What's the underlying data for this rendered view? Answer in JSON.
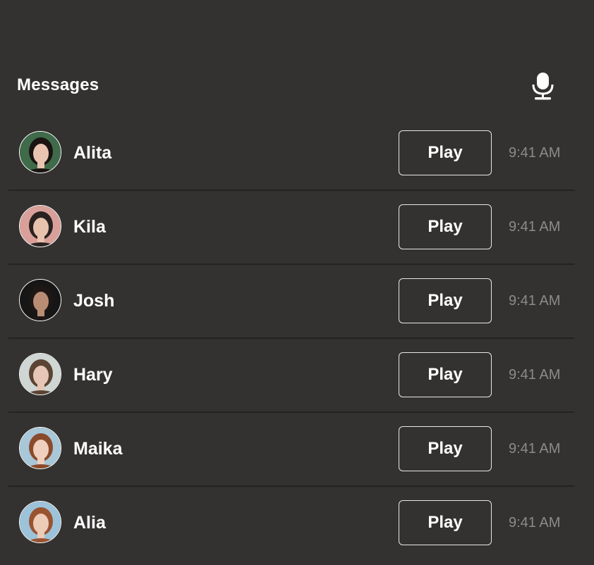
{
  "header": {
    "title": "Messages",
    "mic_icon": "microphone-icon"
  },
  "messages": [
    {
      "name": "Alita",
      "play_label": "Play",
      "time": "9:41 AM",
      "avatar": {
        "bg": "#3f6b4a",
        "skin": "#e9c4b0",
        "hair": "#1a1412"
      }
    },
    {
      "name": "Kila",
      "play_label": "Play",
      "time": "9:41 AM",
      "avatar": {
        "bg": "#d9a09a",
        "skin": "#e7c2ad",
        "hair": "#2a2220"
      }
    },
    {
      "name": "Josh",
      "play_label": "Play",
      "time": "9:41 AM",
      "avatar": {
        "bg": "#161616",
        "skin": "#b98c74",
        "hair": "#1d1715"
      }
    },
    {
      "name": "Hary",
      "play_label": "Play",
      "time": "9:41 AM",
      "avatar": {
        "bg": "#cfd6d3",
        "skin": "#e6c6b4",
        "hair": "#5b4434"
      }
    },
    {
      "name": "Maika",
      "play_label": "Play",
      "time": "9:41 AM",
      "avatar": {
        "bg": "#a8c7d8",
        "skin": "#efcfbd",
        "hair": "#8a4a2c"
      }
    },
    {
      "name": "Alia",
      "play_label": "Play",
      "time": "9:41 AM",
      "avatar": {
        "bg": "#9cc3da",
        "skin": "#eccbb7",
        "hair": "#9a5330"
      }
    }
  ]
}
